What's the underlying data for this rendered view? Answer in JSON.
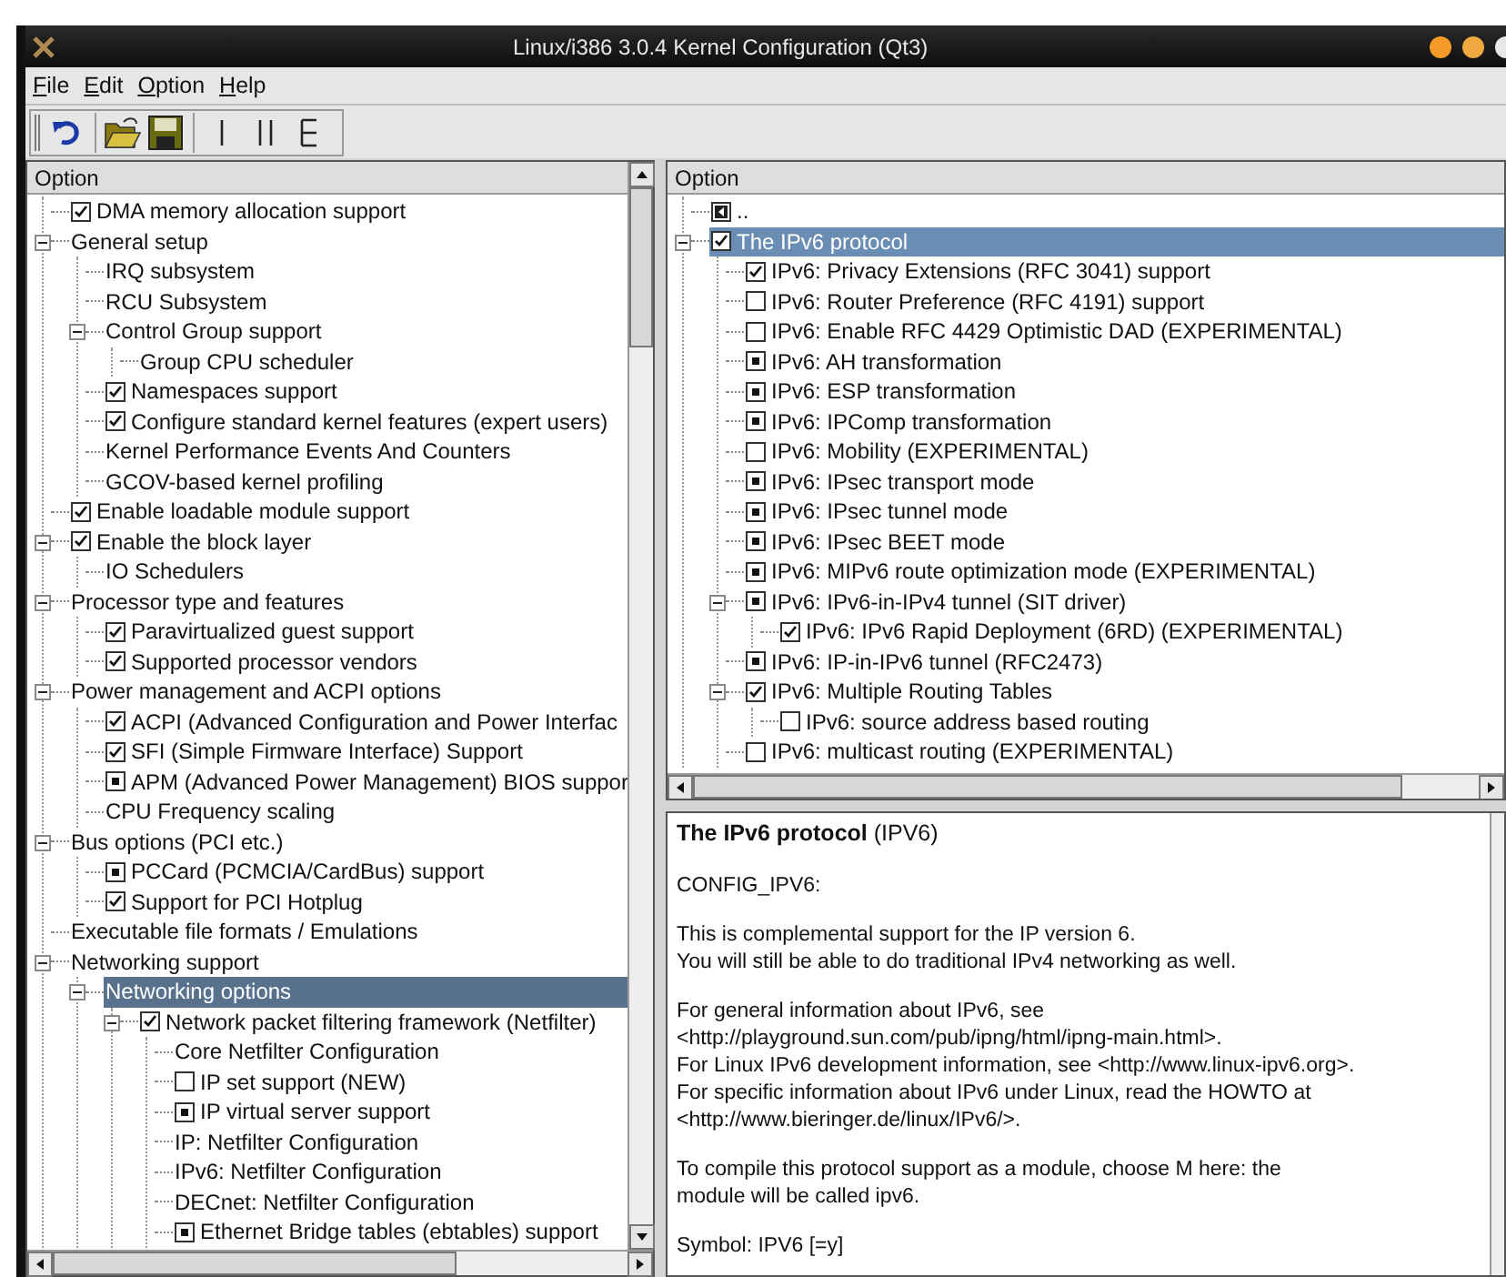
{
  "window": {
    "title": "Linux/i386 3.0.4 Kernel Configuration (Qt3)"
  },
  "menu": [
    "File",
    "Edit",
    "Option",
    "Help"
  ],
  "left_pane": {
    "header": "Option",
    "tree": [
      {
        "label": "DMA memory allocation support",
        "kind": "check",
        "checked": true,
        "selected": false
      },
      {
        "label": "General setup",
        "kind": "menu",
        "expanded": true,
        "selected": false,
        "children": [
          {
            "label": "IRQ subsystem",
            "kind": "menu",
            "selected": false
          },
          {
            "label": "RCU Subsystem",
            "kind": "menu",
            "selected": false
          },
          {
            "label": "Control Group support",
            "kind": "menu",
            "expanded": true,
            "selected": false,
            "children": [
              {
                "label": "Group CPU scheduler",
                "kind": "menu",
                "selected": false
              }
            ]
          },
          {
            "label": "Namespaces support",
            "kind": "check",
            "checked": true,
            "selected": false
          },
          {
            "label": "Configure standard kernel features (expert users)",
            "kind": "check",
            "checked": true,
            "selected": false
          },
          {
            "label": "Kernel Performance Events And Counters",
            "kind": "menu",
            "selected": false
          },
          {
            "label": "GCOV-based kernel profiling",
            "kind": "menu",
            "selected": false
          }
        ]
      },
      {
        "label": "Enable loadable module support",
        "kind": "check",
        "checked": true,
        "selected": false
      },
      {
        "label": "Enable the block layer",
        "kind": "check",
        "checked": true,
        "expanded": true,
        "selected": false,
        "children": [
          {
            "label": "IO Schedulers",
            "kind": "menu",
            "selected": false
          }
        ]
      },
      {
        "label": "Processor type and features",
        "kind": "menu",
        "expanded": true,
        "selected": false,
        "children": [
          {
            "label": "Paravirtualized guest support",
            "kind": "check",
            "checked": true,
            "selected": false
          },
          {
            "label": "Supported processor vendors",
            "kind": "check",
            "checked": true,
            "selected": false
          }
        ]
      },
      {
        "label": "Power management and ACPI options",
        "kind": "menu",
        "expanded": true,
        "selected": false,
        "children": [
          {
            "label": "ACPI (Advanced Configuration and Power Interfac",
            "kind": "check",
            "checked": true,
            "selected": false
          },
          {
            "label": "SFI (Simple Firmware Interface) Support",
            "kind": "check",
            "checked": true,
            "selected": false
          },
          {
            "label": "APM (Advanced Power Management) BIOS suppor",
            "kind": "module",
            "selected": false
          },
          {
            "label": "CPU Frequency scaling",
            "kind": "menu",
            "selected": false
          }
        ]
      },
      {
        "label": "Bus options (PCI etc.)",
        "kind": "menu",
        "expanded": true,
        "selected": false,
        "children": [
          {
            "label": "PCCard (PCMCIA/CardBus) support",
            "kind": "module",
            "selected": false
          },
          {
            "label": "Support for PCI Hotplug",
            "kind": "check",
            "checked": true,
            "selected": false
          }
        ]
      },
      {
        "label": "Executable file formats / Emulations",
        "kind": "menu",
        "selected": false
      },
      {
        "label": "Networking support",
        "kind": "menu",
        "expanded": true,
        "selected": false,
        "children": [
          {
            "label": "Networking options",
            "kind": "menu",
            "expanded": true,
            "selected": true,
            "children": [
              {
                "label": "Network packet filtering framework (Netfilter)",
                "kind": "check",
                "checked": true,
                "expanded": true,
                "selected": false,
                "children": [
                  {
                    "label": "Core Netfilter Configuration",
                    "kind": "menu",
                    "selected": false
                  },
                  {
                    "label": "IP set support (NEW)",
                    "kind": "check",
                    "checked": false,
                    "selected": false
                  },
                  {
                    "label": "IP virtual server support",
                    "kind": "module",
                    "selected": false
                  },
                  {
                    "label": "IP: Netfilter Configuration",
                    "kind": "menu",
                    "selected": false
                  },
                  {
                    "label": "IPv6: Netfilter Configuration",
                    "kind": "menu",
                    "selected": false
                  },
                  {
                    "label": "DECnet: Netfilter Configuration",
                    "kind": "menu",
                    "selected": false
                  },
                  {
                    "label": "Ethernet Bridge tables (ebtables) support",
                    "kind": "module",
                    "selected": false
                  }
                ]
              }
            ]
          }
        ]
      }
    ]
  },
  "right_pane": {
    "header": "Option",
    "tree": [
      {
        "label": "..",
        "kind": "back",
        "selected": false
      },
      {
        "label": "The IPv6 protocol",
        "kind": "check",
        "checked": true,
        "expanded": true,
        "selected": true,
        "children": [
          {
            "label": "IPv6: Privacy Extensions (RFC 3041) support",
            "kind": "check",
            "checked": true,
            "selected": false
          },
          {
            "label": "IPv6: Router Preference (RFC 4191) support",
            "kind": "check",
            "checked": false,
            "selected": false
          },
          {
            "label": "IPv6: Enable RFC 4429 Optimistic DAD (EXPERIMENTAL)",
            "kind": "check",
            "checked": false,
            "selected": false
          },
          {
            "label": "IPv6: AH transformation",
            "kind": "module",
            "selected": false
          },
          {
            "label": "IPv6: ESP transformation",
            "kind": "module",
            "selected": false
          },
          {
            "label": "IPv6: IPComp transformation",
            "kind": "module",
            "selected": false
          },
          {
            "label": "IPv6: Mobility (EXPERIMENTAL)",
            "kind": "check",
            "checked": false,
            "selected": false
          },
          {
            "label": "IPv6: IPsec transport mode",
            "kind": "module",
            "selected": false
          },
          {
            "label": "IPv6: IPsec tunnel mode",
            "kind": "module",
            "selected": false
          },
          {
            "label": "IPv6: IPsec BEET mode",
            "kind": "module",
            "selected": false
          },
          {
            "label": "IPv6: MIPv6 route optimization mode (EXPERIMENTAL)",
            "kind": "module",
            "selected": false
          },
          {
            "label": "IPv6: IPv6-in-IPv4 tunnel (SIT driver)",
            "kind": "module",
            "expanded": true,
            "selected": false,
            "children": [
              {
                "label": "IPv6: IPv6 Rapid Deployment (6RD) (EXPERIMENTAL)",
                "kind": "check",
                "checked": true,
                "selected": false
              }
            ]
          },
          {
            "label": "IPv6: IP-in-IPv6 tunnel (RFC2473)",
            "kind": "module",
            "selected": false
          },
          {
            "label": "IPv6: Multiple Routing Tables",
            "kind": "check",
            "checked": true,
            "expanded": true,
            "selected": false,
            "children": [
              {
                "label": "IPv6: source address based routing",
                "kind": "check",
                "checked": false,
                "selected": false
              }
            ]
          },
          {
            "label": "IPv6: multicast routing (EXPERIMENTAL)",
            "kind": "check",
            "checked": false,
            "selected": false
          }
        ]
      }
    ]
  },
  "help": {
    "title": "**The IPv6 protocol** (IPV6)",
    "paragraphs": [
      "CONFIG_IPV6:",
      "This is complemental support for the IP version 6.\nYou will still be able to do traditional IPv4 networking as well.",
      "For general information about IPv6, see\n<http://playground.sun.com/pub/ipng/html/ipng-main.html>.\nFor Linux IPv6 development information, see <http://www.linux-ipv6.org>.\nFor specific information about IPv6 under Linux, read the HOWTO at\n<http://www.bieringer.de/linux/IPv6/>.",
      "To compile this protocol support as a module, choose M here: the\nmodule will be called ipv6.",
      "Symbol: IPV6 [=y]"
    ]
  }
}
